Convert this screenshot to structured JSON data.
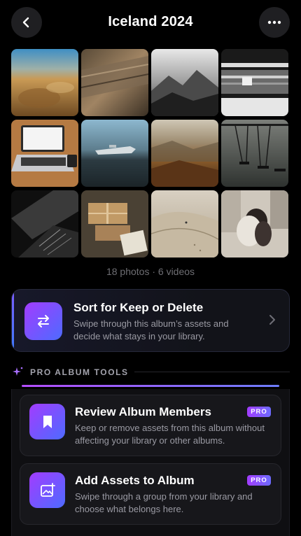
{
  "header": {
    "title": "Iceland 2024",
    "back_icon": "chevron-left-icon",
    "more_icon": "ellipsis-icon"
  },
  "gallery": {
    "thumbnails": [
      {
        "name": "photo-beach-grass"
      },
      {
        "name": "photo-driftwood"
      },
      {
        "name": "photo-misty-mountains"
      },
      {
        "name": "photo-train-blur"
      },
      {
        "name": "photo-laptop-desk"
      },
      {
        "name": "photo-plane-wreck"
      },
      {
        "name": "photo-autumn-valley"
      },
      {
        "name": "photo-swings"
      },
      {
        "name": "photo-building-bw"
      },
      {
        "name": "photo-parcels"
      },
      {
        "name": "photo-sand-dunes"
      },
      {
        "name": "photo-couple-city"
      }
    ],
    "counts_text": "18 photos · 6 videos"
  },
  "sort_card": {
    "title": "Sort for Keep or Delete",
    "description": "Swipe through this album’s assets and decide what stays in your library.",
    "icon": "swap-arrows-icon",
    "accent": "#6d5cff"
  },
  "pro_section": {
    "label": "PRO ALBUM TOOLS",
    "icon": "sparkle-icon",
    "tools": [
      {
        "title": "Review Album Members",
        "badge": "PRO",
        "description": "Keep or remove assets from this album without affecting your library or other albums.",
        "icon": "bookmark-icon"
      },
      {
        "title": "Add Assets to Album",
        "badge": "PRO",
        "description": "Swipe through a group from your library and choose what belongs here.",
        "icon": "image-add-icon"
      }
    ]
  },
  "colors": {
    "background": "#000000",
    "accent_start": "#a23cff",
    "accent_end": "#4d6bff",
    "muted_text": "#9a9aa3"
  }
}
